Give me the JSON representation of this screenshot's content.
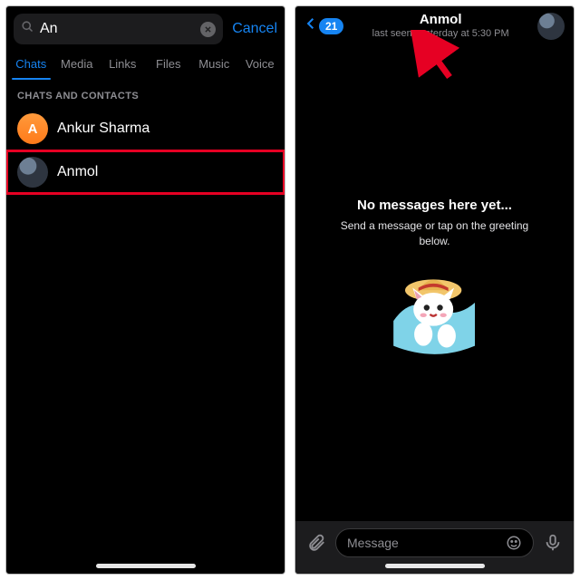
{
  "left": {
    "search": {
      "value": "An",
      "cancel": "Cancel"
    },
    "tabs": [
      "Chats",
      "Media",
      "Links",
      "Files",
      "Music",
      "Voice"
    ],
    "active_tab": 0,
    "section_header": "CHATS AND CONTACTS",
    "results": [
      {
        "initial": "A",
        "name": "Ankur Sharma"
      },
      {
        "initial": "",
        "name": "Anmol"
      }
    ]
  },
  "right": {
    "badge": "21",
    "title": "Anmol",
    "subtitle": "last seen yesterday at 5:30 PM",
    "empty_title": "No messages here yet...",
    "empty_sub": "Send a message or tap on the greeting below.",
    "input_placeholder": "Message"
  }
}
